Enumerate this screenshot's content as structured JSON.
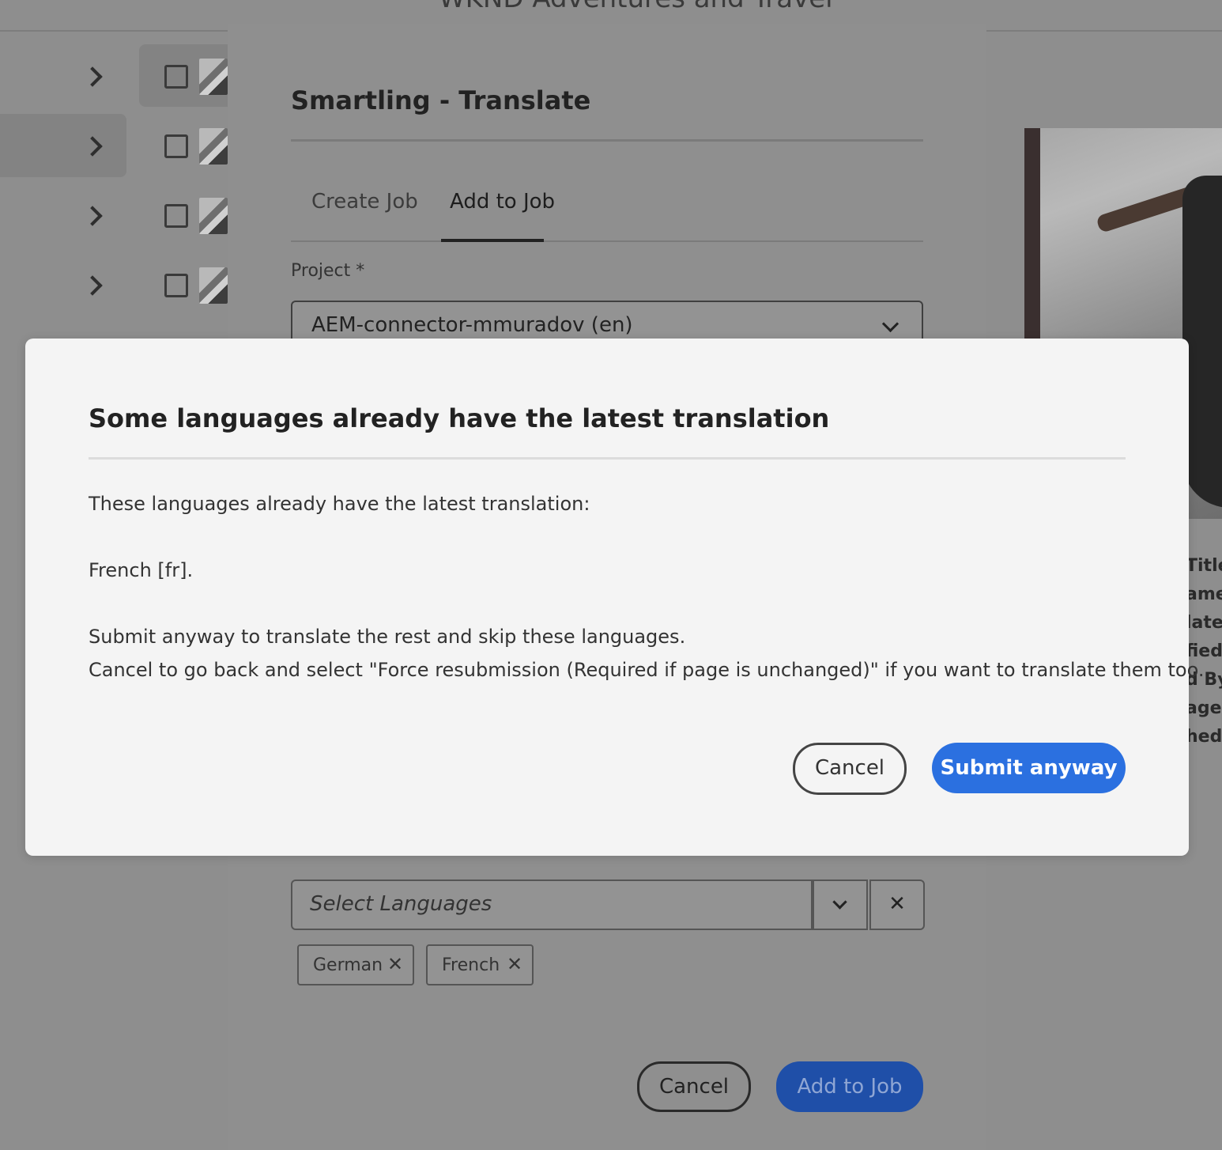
{
  "background": {
    "page_header_title": "WKND Adventures and Travel",
    "panel": {
      "title": "Smartling - Translate",
      "tabs": [
        {
          "label": "Create Job",
          "active": false
        },
        {
          "label": "Add to Job",
          "active": true
        }
      ],
      "project_label": "Project *",
      "project_value": "AEM-connector-mmuradov (en)",
      "languages_placeholder": "Select Languages",
      "selected_languages": [
        "German",
        "French"
      ],
      "chip_remove_glyph": "✕",
      "clear_glyph": "✕",
      "cancel_label": "Cancel",
      "submit_label": "Add to Job"
    },
    "metadata_labels": [
      "Title",
      "ame",
      "late",
      "fied",
      "d By",
      "age",
      "hed"
    ]
  },
  "modal": {
    "title": "Some languages already have the latest translation",
    "lines": [
      "These languages already have the latest translation:",
      "French [fr].",
      "Submit anyway to translate the rest and skip these languages.",
      "Cancel to go back and select \"Force resubmission (Required if page is unchanged)\" if you want to translate them too."
    ],
    "cancel_label": "Cancel",
    "submit_label": "Submit anyway"
  },
  "colors": {
    "overlay": "#8e8e8e",
    "modal_bg": "#f4f4f4",
    "primary": "#2b70e0"
  }
}
